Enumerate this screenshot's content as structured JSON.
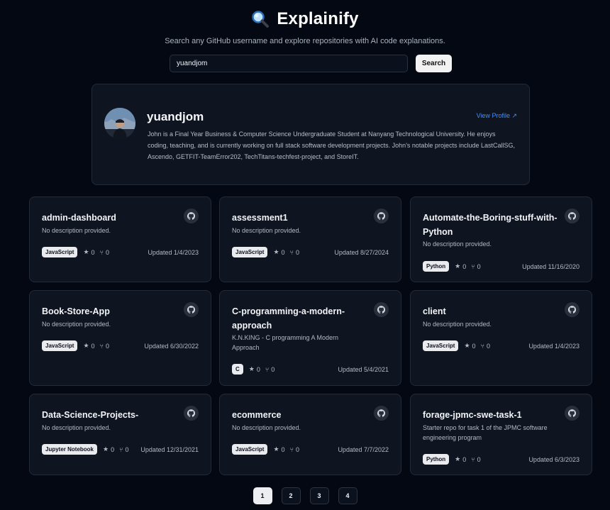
{
  "app": {
    "title": "Explainify",
    "subtitle": "Search any GitHub username and explore repositories with AI code explanations."
  },
  "search": {
    "value": "yuandjom",
    "button_label": "Search"
  },
  "profile": {
    "username": "yuandjom",
    "view_profile_label": "View Profile ↗",
    "bio": "John is a Final Year Business & Computer Science Undergraduate Student at Nanyang Technological University. He enjoys coding, teaching, and is currently working on full stack software development projects. John's notable projects include LastCallSG, Ascendo, GETFIT-TeamError202, TechTitans-techfest-project, and StoreIT."
  },
  "repos": [
    {
      "name": "admin-dashboard",
      "description": "No description provided.",
      "language": "JavaScript",
      "stars": "0",
      "forks": "0",
      "updated": "Updated 1/4/2023"
    },
    {
      "name": "assessment1",
      "description": "No description provided.",
      "language": "JavaScript",
      "stars": "0",
      "forks": "0",
      "updated": "Updated 8/27/2024"
    },
    {
      "name": "Automate-the-Boring-stuff-with-Python",
      "description": "No description provided.",
      "language": "Python",
      "stars": "0",
      "forks": "0",
      "updated": "Updated 11/16/2020"
    },
    {
      "name": "Book-Store-App",
      "description": "No description provided.",
      "language": "JavaScript",
      "stars": "0",
      "forks": "0",
      "updated": "Updated 6/30/2022"
    },
    {
      "name": "C-programming-a-modern-approach",
      "description": "K.N.KING - C programming A Modern Approach",
      "language": "C",
      "stars": "0",
      "forks": "0",
      "updated": "Updated 5/4/2021"
    },
    {
      "name": "client",
      "description": "No description provided.",
      "language": "JavaScript",
      "stars": "0",
      "forks": "0",
      "updated": "Updated 1/4/2023"
    },
    {
      "name": "Data-Science-Projects-",
      "description": "No description provided.",
      "language": "Jupyter Notebook",
      "stars": "0",
      "forks": "0",
      "updated": "Updated 12/31/2021"
    },
    {
      "name": "ecommerce",
      "description": "No description provided.",
      "language": "JavaScript",
      "stars": "0",
      "forks": "0",
      "updated": "Updated 7/7/2022"
    },
    {
      "name": "forage-jpmc-swe-task-1",
      "description": "Starter repo for task 1 of the JPMC software engineering program",
      "language": "Python",
      "stars": "0",
      "forks": "0",
      "updated": "Updated 6/3/2023"
    }
  ],
  "pagination": {
    "pages": [
      "1",
      "2",
      "3",
      "4"
    ],
    "current": "1"
  },
  "icons": {
    "title_icon": "magnifying-glass-icon",
    "repo_link_icon": "github-icon",
    "star_icon": "star-icon",
    "fork_icon": "fork-icon"
  },
  "colors": {
    "background": "#040812",
    "card": "#0e1420",
    "link": "#4a8ef0",
    "badge": "#e9ebef"
  }
}
